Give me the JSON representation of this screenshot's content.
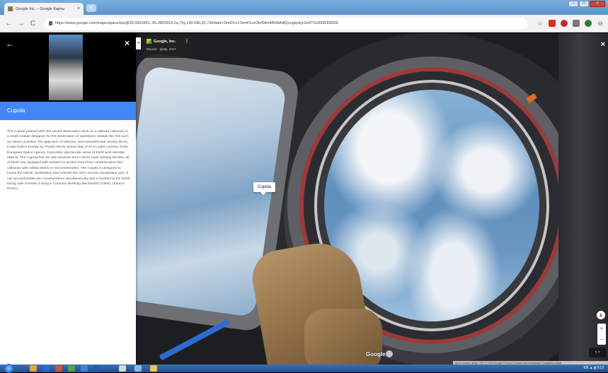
{
  "browser": {
    "tab_title": "Google Inc. – Google Карты",
    "tab_close": "×",
    "new_tab": "+",
    "url": "https://www.google.com/maps/space/iss/@29.5602851,-95.0853914,2a,75y,199.63h,92.72t/data=!3m6!1e1!3m4!1szOtzf9An4R0AA4iQoogbyEg!2e0!7i10000!8i5000",
    "back": "←",
    "forward": "→",
    "reload": "C",
    "window_buttons": [
      "–",
      "□",
      "×"
    ]
  },
  "panel": {
    "back_label": "←",
    "close_label": "×",
    "title": "Cupola",
    "description": "The Cupola (named after the raised observation deck on a railroad caboose) is a small module designed for the observation of operations outside the ISS such as robotic activities, the approach of vehicles, and extravehicular activity (EVA). It was built in Europe by Thales Alenia Space Italy (TAS-I) under contract of the European Space Agency. It provides spectacular views of Earth and celestial objects. The Cupola has six side windows and a direct nadir viewing window, all of which are equipped with shutters to protect them from contamination and collisions with orbital debris or micrometeorites. The Cupola is designed to house the robotic workstation that controls the ISS's remote manipulator arm. It can accommodate two crewmembers simultaneously and is berthed to the Earth facing side of Node-3 using a Common Berthing Mechanism (CBM). (Source: NASA)",
    "collapse": "◂"
  },
  "scene": {
    "place_name": "Google, Inc.",
    "place_more": "⋮",
    "place_date": "Внутри – февр. 2017",
    "label": "Cupola",
    "close": "×",
    "google_mark": "Google",
    "footer": "Дата съемки: февр. 2017   © 2019 Google   Россия   Условия использования   Отправить отзыв",
    "zoom_in": "+",
    "zoom_out": "–",
    "nav": "‹ ›"
  },
  "taskbar": {
    "tray": "EN  ▲  ▮  9:12"
  }
}
